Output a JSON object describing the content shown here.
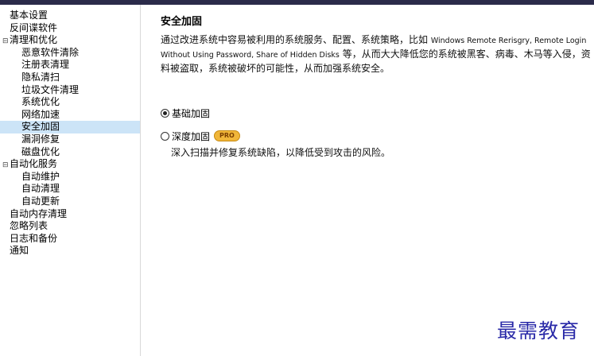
{
  "sidebar": {
    "items": [
      {
        "label": "基本设置",
        "level": 0
      },
      {
        "label": "反间谍软件",
        "level": 0
      },
      {
        "label": "清理和优化",
        "level": 0,
        "expanded": true
      },
      {
        "label": "恶意软件清除",
        "level": 1
      },
      {
        "label": "注册表清理",
        "level": 1
      },
      {
        "label": "隐私清扫",
        "level": 1
      },
      {
        "label": "垃圾文件清理",
        "level": 1
      },
      {
        "label": "系统优化",
        "level": 1
      },
      {
        "label": "网络加速",
        "level": 1
      },
      {
        "label": "安全加固",
        "level": 1,
        "selected": true
      },
      {
        "label": "漏洞修复",
        "level": 1
      },
      {
        "label": "磁盘优化",
        "level": 1
      },
      {
        "label": "自动化服务",
        "level": 0,
        "expanded": true
      },
      {
        "label": "自动维护",
        "level": 1
      },
      {
        "label": "自动清理",
        "level": 1
      },
      {
        "label": "自动更新",
        "level": 1
      },
      {
        "label": "自动内存清理",
        "level": 0
      },
      {
        "label": "忽略列表",
        "level": 0
      },
      {
        "label": "日志和备份",
        "level": 0
      },
      {
        "label": "通知",
        "level": 0
      }
    ]
  },
  "main": {
    "title": "安全加固",
    "description": {
      "part1": "通过改进系统中容易被利用的系统服务、配置、系统策略，比如 ",
      "latin1": "Windows Remote Rerisgry, Remote Login Without Using Password, Share of Hidden Disks",
      "part2": " 等，从而大大降低您的系统被黑客、病毒、木马等入侵，资料被盗取，系统被破坏的可能性，从而加强系统安全。"
    },
    "options": {
      "basic": {
        "label": "基础加固",
        "checked": true
      },
      "deep": {
        "label": "深度加固",
        "checked": false,
        "badge": "PRO",
        "desc": "深入扫描并修复系统缺陷，以降低受到攻击的风险。"
      }
    }
  },
  "watermark": "最需教育",
  "colors": {
    "selected_bg": "#cce4f7",
    "pro_badge": "#f0b63a",
    "watermark": "#2a2aa8",
    "topbar": "#2b2b4a"
  }
}
